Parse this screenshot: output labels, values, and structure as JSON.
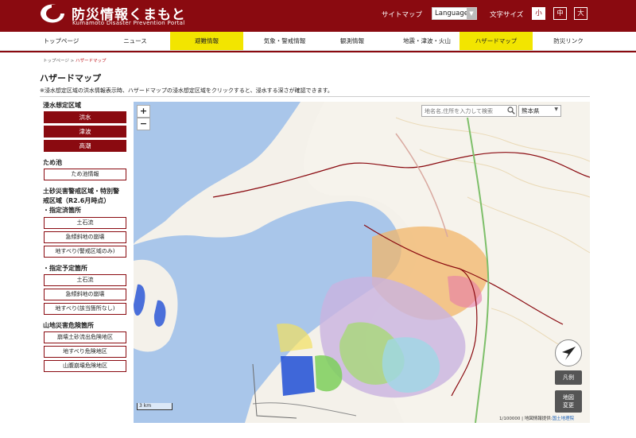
{
  "header": {
    "logo_title": "防災情報くまもと",
    "logo_subtitle": "Kumamoto Disaster Prevention Portal",
    "sitemap": "サイトマップ",
    "language": "Language",
    "font_size_label": "文字サイズ",
    "font_sizes": [
      "小",
      "中",
      "大"
    ],
    "brand_color": "#8a0a10"
  },
  "nav": {
    "items": [
      {
        "label": "トップページ",
        "highlighted": false
      },
      {
        "label": "ニュース",
        "highlighted": false
      },
      {
        "label": "避難情報",
        "highlighted": true
      },
      {
        "label": "気象・警戒情報",
        "highlighted": false
      },
      {
        "label": "観測情報",
        "highlighted": false
      },
      {
        "label": "地震・津波・火山",
        "highlighted": false
      },
      {
        "label": "ハザードマップ",
        "highlighted": true
      },
      {
        "label": "防災リンク",
        "highlighted": false
      }
    ],
    "highlight_color": "#f2e500"
  },
  "breadcrumb": {
    "home": "トップページ",
    "separator": " > ",
    "current": "ハザードマップ"
  },
  "page": {
    "title": "ハザードマップ",
    "notice": "※浸水想定区域の洪水情報表示時、ハザードマップの浸水想定区域をクリックすると、浸水する深さが確認できます。"
  },
  "sidebar": {
    "flood_heading": "浸水想定区域",
    "flood_buttons": [
      "洪水",
      "津波",
      "高潮"
    ],
    "pond_heading": "ため池",
    "pond_buttons": [
      "ため池情報"
    ],
    "sediment_heading_1": "土砂災害警戒区域・特別警",
    "sediment_heading_2": "戒区域（R2.6月時点）",
    "designated_heading": "・指定済箇所",
    "designated_buttons": [
      "土石流",
      "急傾斜地の崩壊",
      "地すべり(警戒区域のみ)"
    ],
    "planned_heading": "・指定予定箇所",
    "planned_buttons": [
      "土石流",
      "急傾斜地の崩壊",
      "地すべり(該当箇所なし)"
    ],
    "mountain_heading": "山地災害危険箇所",
    "mountain_buttons": [
      "崩壊土砂流出危険地区",
      "地すべり危険地区",
      "山腹崩壊危険地区"
    ]
  },
  "map": {
    "zoom_in": "+",
    "zoom_out": "−",
    "search_placeholder": "地名名,住所を入力して検索",
    "search_icon": "search-icon",
    "prefecture": "熊本県",
    "legend_button": "凡例",
    "change_map_1": "地図",
    "change_map_2": "変更",
    "scale": "3 km",
    "scale_ratio": "1/100000",
    "attribution": "地図情報提供:",
    "attribution_link": "国土地理院",
    "location_icon": "location-arrow-icon",
    "sea_color": "#a9c6ea"
  }
}
